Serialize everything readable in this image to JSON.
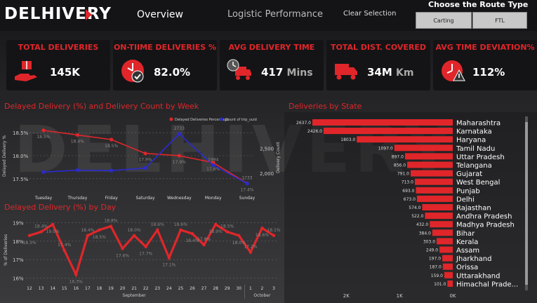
{
  "brand": {
    "logo_text": "DELHIVERY",
    "accent": "#e0262a"
  },
  "nav": {
    "overview": "Overview",
    "logistic": "Logistic Performance",
    "clear": "Clear Selection"
  },
  "route": {
    "title": "Choose the Route Type",
    "options": [
      "Carting",
      "FTL"
    ]
  },
  "kpis": [
    {
      "title": "TOTAL DELIVERIES",
      "value": "145K",
      "unit": "",
      "icon": "hand-box-icon"
    },
    {
      "title": "ON-TIIME DELIVERIES %",
      "value": "82.0%",
      "unit": "",
      "icon": "clock-check-icon"
    },
    {
      "title": "AVG DELIVERY TIME",
      "value": "417",
      "unit": "Mins",
      "icon": "truck-clock-icon"
    },
    {
      "title": "TOTAL DIST. COVERED",
      "value": "34M",
      "unit": "Km",
      "icon": "truck-icon"
    },
    {
      "title": "AVG TIME DEVIATION%",
      "value": "112%",
      "unit": "",
      "icon": "alert-clock-icon"
    }
  ],
  "chart_data": [
    {
      "type": "line",
      "title": "Delayed Delivery (%) and Delivery Count by Week",
      "categories": [
        "Tuesday",
        "Thursday",
        "Friday",
        "Saturday",
        "Wednesday",
        "Monday",
        "Sunday"
      ],
      "ylabel": "Delayed Delivery %",
      "y2label": "Delivery Count",
      "yticks": [
        "18.5%",
        "18.0%",
        "17.5%"
      ],
      "y2ticks": [
        "2,500",
        "2,000"
      ],
      "ylim": [
        17.3,
        18.7
      ],
      "y2lim": [
        1700,
        3000
      ],
      "series": [
        {
          "name": "Delayed Deliveries Percentage",
          "color": "#e0262a",
          "values": [
            18.55,
            18.45,
            18.35,
            18.05,
            18.0,
            17.85,
            17.4
          ],
          "labels": [
            "18.5%",
            "18.4%",
            "18.5%",
            "17.9%",
            "17.9%",
            "17.8%",
            "17.4%"
          ]
        },
        {
          "name": "Count of trip_uuid",
          "color": "#2b2bd0",
          "values": [
            2020,
            2060,
            2050,
            2100,
            2790,
            2160,
            1790
          ],
          "labels": [
            "",
            "",
            "",
            "",
            "2733",
            "1994",
            "1733"
          ]
        }
      ]
    },
    {
      "type": "line",
      "title": "Delayed Delivery (%) by Day",
      "x": [
        "12",
        "13",
        "14",
        "15",
        "16",
        "17",
        "18",
        "19",
        "20",
        "21",
        "22",
        "23",
        "24",
        "25",
        "26",
        "27",
        "28",
        "29",
        "30",
        "1",
        "2",
        "3"
      ],
      "xgroups": [
        "September",
        "October"
      ],
      "ylabel": "% of Deliveries",
      "yticks": [
        "19%",
        "18%",
        "17%",
        "16%"
      ],
      "ylim": [
        15.8,
        19.2
      ],
      "values": [
        18.3,
        18.5,
        18.9,
        17.5,
        16.2,
        18.3,
        18.6,
        18.8,
        17.6,
        18.3,
        17.7,
        18.6,
        17.1,
        18.6,
        18.4,
        17.8,
        18.9,
        18.5,
        18.3,
        17.4,
        18.7,
        18.3
      ],
      "labels": [
        "18.3%",
        "18.4%",
        "19.0%",
        "17.4%",
        "16.3%",
        "18.4%",
        "18.5%",
        "18.8%",
        "17.6%",
        "18.0%",
        "17.7%",
        "18.6%",
        "17.1%",
        "18.6%",
        "18.4%",
        "17.8%",
        "18.9%",
        "18.5%",
        "18.0%",
        "17.2%",
        "18.6%",
        "18.1%"
      ]
    },
    {
      "type": "bar",
      "orientation": "horizontal",
      "title": "Deliveries by State",
      "categories": [
        "Maharashtra",
        "Karnataka",
        "Haryana",
        "Tamil Nadu",
        "Uttar Pradesh",
        "Telangana",
        "Gujarat",
        "West Bengal",
        "Punjab",
        "Delhi",
        "Rajasthan",
        "Andhra Pradesh",
        "Madhya Pradesh",
        "Bihar",
        "Kerala",
        "Assam",
        "Jharkhand",
        "Orissa",
        "Uttarakhand",
        "Himachal Prade..."
      ],
      "values": [
        2637,
        2426,
        1803,
        1097,
        897,
        856,
        791,
        713,
        693,
        673,
        574,
        522,
        432,
        384,
        303,
        249,
        197,
        187,
        159,
        101
      ],
      "value_labels": [
        "2637.0",
        "2426.0",
        "1803.0",
        "1097.0",
        "897.0",
        "856.0",
        "791.0",
        "713.0",
        "693.0",
        "673.0",
        "574.0",
        "522.0",
        "432.0",
        "384.0",
        "303.0",
        "249.0",
        "197.0",
        "187.0",
        "159.0",
        "101.0"
      ],
      "xticks": [
        "2K",
        "1K",
        "0K"
      ],
      "xlim": [
        0,
        3000
      ]
    }
  ]
}
